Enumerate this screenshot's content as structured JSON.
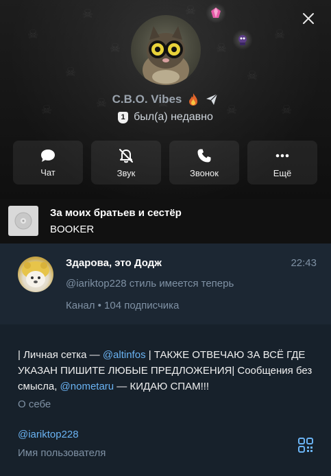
{
  "profile": {
    "name": "C.B.O. Vibes",
    "status": "был(а) недавно",
    "badge": "1"
  },
  "actions": [
    {
      "label": "Чат",
      "icon": "chat-bubble-icon"
    },
    {
      "label": "Звук",
      "icon": "bell-muted-icon"
    },
    {
      "label": "Звонок",
      "icon": "phone-icon"
    },
    {
      "label": "Ещё",
      "icon": "more-dots-icon"
    }
  ],
  "music": {
    "title": "За моих братьев и сестёр",
    "artist": "BOOKER"
  },
  "channel": {
    "title": "Здарова, это Додж",
    "time": "22:43",
    "last_message": "@iariktop228 стиль имеется теперь",
    "info": "Канал • 104 подписчика"
  },
  "bio": {
    "part1": "| Личная сетка — ",
    "link1": "@altinfos",
    "part2": " | ТАКЖЕ ОТВЕЧАЮ ЗА ВСЁ ГДЕ УКАЗАН ПИШИТЕ ЛЮБЫЕ ПРЕДЛОЖЕНИЯ| Сообщения без смысла, ",
    "link2": "@nometaru",
    "part3": " — КИДАЮ СПАМ!!!",
    "caption": "О себе"
  },
  "username": {
    "value": "@iariktop228",
    "caption": "Имя пользователя"
  },
  "colors": {
    "accent_link": "#6ab3f3",
    "background": "#17212b",
    "muted_text": "#7f91a4"
  }
}
